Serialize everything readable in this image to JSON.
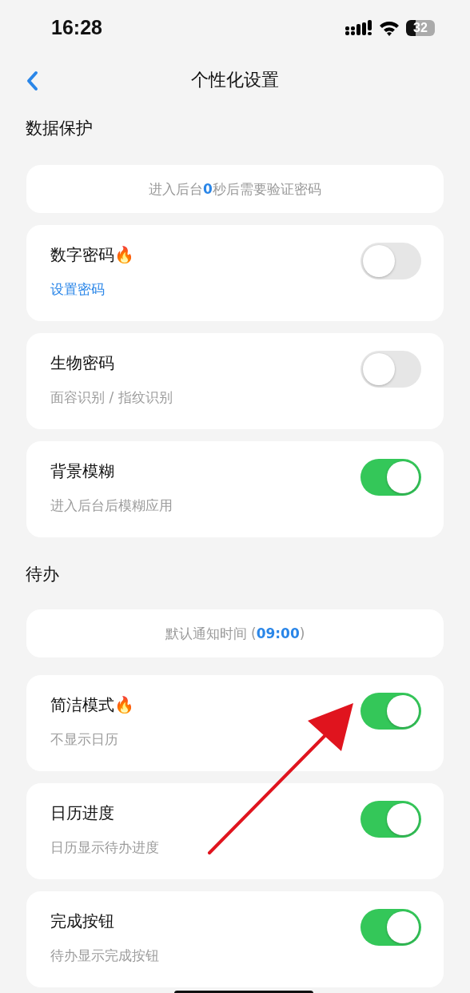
{
  "status_bar": {
    "time": "16:28",
    "battery": "32"
  },
  "nav": {
    "title": "个性化设置"
  },
  "sections": [
    {
      "title": "数据保护",
      "info": "进入后台**0**秒后需要验证密码",
      "rows": [
        {
          "title": "数字密码🔥",
          "subtitle": "设置密码",
          "link": true,
          "on": false
        },
        {
          "title": "生物密码",
          "subtitle": "面容识别 / 指纹识别",
          "link": false,
          "on": false
        },
        {
          "title": "背景模糊",
          "subtitle": "进入后台后模糊应用",
          "link": false,
          "on": true
        }
      ]
    },
    {
      "title": "待办",
      "info": "默认通知时间 (**09:00**)",
      "rows": [
        {
          "title": "简洁模式🔥",
          "subtitle": "不显示日历",
          "link": false,
          "on": true
        },
        {
          "title": "日历进度",
          "subtitle": "日历显示待办进度",
          "link": false,
          "on": true
        },
        {
          "title": "完成按钮",
          "subtitle": "待办显示完成按钮",
          "link": false,
          "on": true
        }
      ]
    }
  ]
}
